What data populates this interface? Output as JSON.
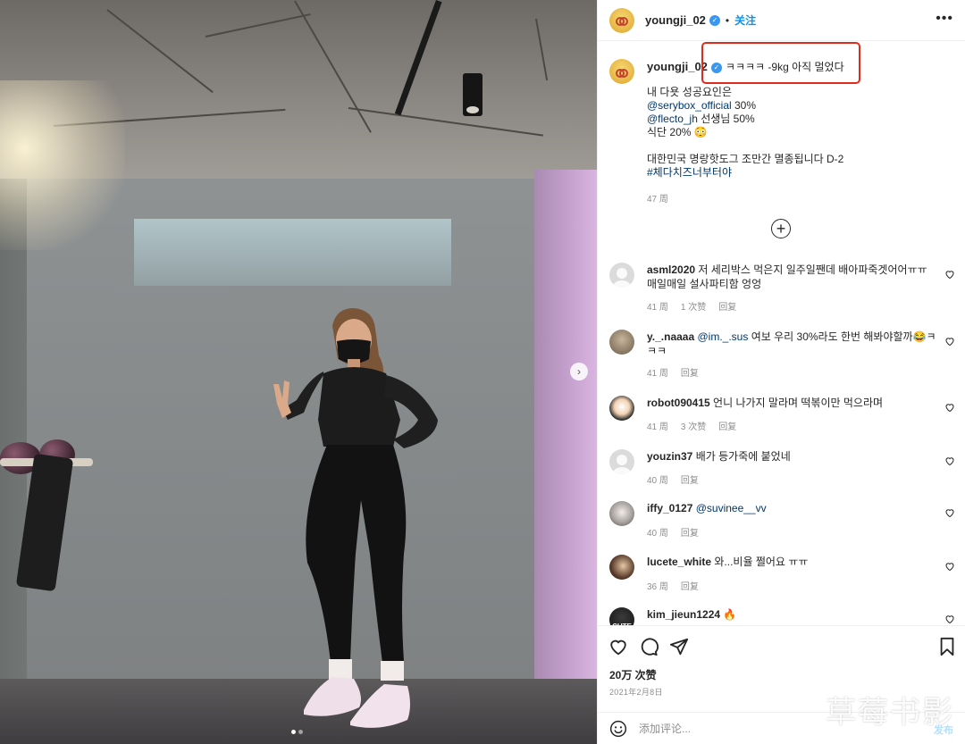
{
  "post_header": {
    "username": "youngji_02",
    "separator": "•",
    "follow_label": "关注",
    "more_label": "•••"
  },
  "caption": {
    "username": "youngji_02",
    "first_line": "ㅋㅋㅋㅋ -9kg 아직 멀었다",
    "lines": [
      {
        "text": "내 다욧 성공요인은",
        "type": "text"
      },
      {
        "mention": "@serybox_official",
        "rest": " 30%"
      },
      {
        "mention": "@flecto_jh",
        "rest": " 선생님 50%"
      },
      {
        "text": "식단 20% 😳",
        "type": "text"
      },
      {
        "text": "",
        "type": "blank"
      },
      {
        "text": "대한민국 명랑핫도그 조만간 멸종됩니다 D-2",
        "type": "text"
      },
      {
        "hashtag": "#체다치즈너부터야"
      }
    ],
    "time": "47 周"
  },
  "load_more_icon": "plus-circle-icon",
  "comments": [
    {
      "user": "asml2020",
      "text": "저 세리박스 먹은지 일주일짼데 배아파죽겟어어ㅠㅠ 매일매일 설사파티함 엉엉",
      "time": "41 周",
      "likes": "1 次赞",
      "reply": "回复",
      "avatar": "blank"
    },
    {
      "user": "y._.naaaa",
      "mention": "@im._.sus",
      "text": "여보 우리 30%라도 한번 해봐야할까😂ㅋㅋㅋ",
      "time": "41 周",
      "likes": "",
      "reply": "回复",
      "avatar": "photo1"
    },
    {
      "user": "robot090415",
      "text": "언니 나가지 말라며 떡볶이만 먹으라며",
      "time": "41 周",
      "likes": "3 次赞",
      "reply": "回复",
      "avatar": "photo2"
    },
    {
      "user": "youzin37",
      "text": "배가 등가죽에 붙었네",
      "time": "40 周",
      "likes": "",
      "reply": "回复",
      "avatar": "blank"
    },
    {
      "user": "iffy_0127",
      "mention": "@suvinee__vv",
      "text": "",
      "time": "40 周",
      "likes": "",
      "reply": "回复",
      "avatar": "photo3"
    },
    {
      "user": "lucete_white",
      "text": "와...비율 쩔어요 ㅠㅠ",
      "time": "36 周",
      "likes": "",
      "reply": "回复",
      "avatar": "photo4"
    },
    {
      "user": "kim_jieun1224",
      "text": "🔥",
      "time": "",
      "likes": "",
      "reply": "",
      "avatar": "photo5",
      "avatar_text": "CUTE"
    }
  ],
  "actions": {
    "like_icon": "heart-icon",
    "comment_icon": "comment-icon",
    "share_icon": "send-icon",
    "save_icon": "bookmark-icon",
    "likes_count": "20万 次赞",
    "date": "2021年2月8日"
  },
  "comment_box": {
    "placeholder": "添加评论...",
    "post_label": "发布",
    "emoji_icon": "smiley-icon"
  },
  "watermark": "草莓书影",
  "colors": {
    "link": "#00376b",
    "follow": "#0095f6",
    "verified": "#3897f0",
    "highlight_box": "#e02a1e"
  }
}
